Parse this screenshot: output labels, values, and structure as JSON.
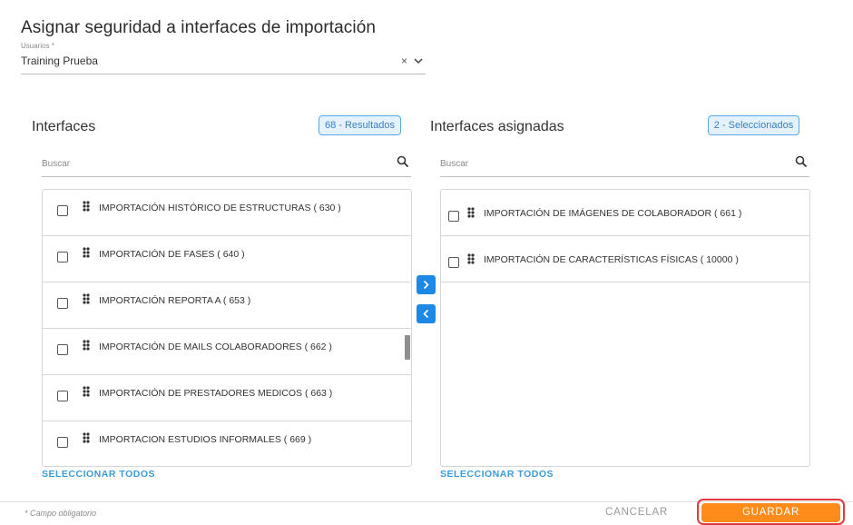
{
  "header": {
    "title": "Asignar seguridad a interfaces de importación"
  },
  "user_field": {
    "label": "Usuarios *",
    "value": "Training Prueba",
    "clear_icon": "×"
  },
  "left_panel": {
    "title": "Interfaces",
    "badge": "68 - Resultados",
    "search_placeholder": "Buscar",
    "items": [
      {
        "label": "IMPORTACIÓN HISTÓRICO DE ESTRUCTURAS ( 630 )",
        "checked": false
      },
      {
        "label": "IMPORTACIÓN DE FASES ( 640 )",
        "checked": false
      },
      {
        "label": "IMPORTACIÓN REPORTA A ( 653 )",
        "checked": false
      },
      {
        "label": "IMPORTACIÓN DE MAILS COLABORADORES ( 662 )",
        "checked": false
      },
      {
        "label": "IMPORTACIÓN DE PRESTADORES MEDICOS ( 663 )",
        "checked": false
      },
      {
        "label": "IMPORTACION ESTUDIOS INFORMALES ( 669 )",
        "checked": false
      }
    ],
    "select_all": "SELECCIONAR TODOS"
  },
  "right_panel": {
    "title": "Interfaces asignadas",
    "badge": "2 - Seleccionados",
    "search_placeholder": "Buscar",
    "items": [
      {
        "label": "IMPORTACIÓN DE IMÁGENES DE COLABORADOR ( 661 )",
        "checked": false
      },
      {
        "label": "IMPORTACIÓN DE CARACTERÍSTICAS FÍSICAS ( 10000 )",
        "checked": false
      }
    ],
    "select_all": "SELECCIONAR TODOS"
  },
  "footer": {
    "required_note": "* Campo obligatorio",
    "cancel_label": "CANCELAR",
    "save_label": "GUARDAR"
  },
  "colors": {
    "accent_blue": "#1e88e5",
    "link_blue": "#3d9bd9",
    "save_orange": "#ff8c1a",
    "highlight_red": "#e03a3a"
  }
}
